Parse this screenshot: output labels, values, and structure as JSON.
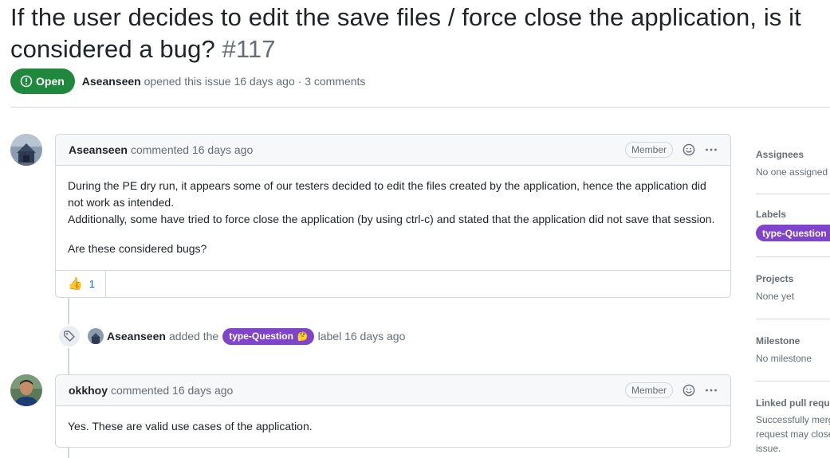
{
  "issue": {
    "title": "If the user decides to edit the save files / force close the application, is it considered a bug?",
    "number": "#117",
    "state": "Open",
    "author": "Aseanseen",
    "meta_suffix": "opened this issue 16 days ago · 3 comments"
  },
  "comments": [
    {
      "author": "Aseanseen",
      "action": "commented 16 days ago",
      "role": "Member",
      "body": [
        "During the PE dry run, it appears some of our testers decided to edit the files created by the application, hence the application did not work as intended.",
        "Additionally, some have tried to force close the application (by using ctrl-c) and stated that the application did not save that session.",
        "Are these considered bugs?"
      ],
      "reaction": {
        "emoji": "👍",
        "count": "1"
      }
    },
    {
      "author": "okkhoy",
      "action": "commented 16 days ago",
      "role": "Member",
      "body": [
        "Yes. These are valid use cases of the application."
      ]
    }
  ],
  "event": {
    "actor": "Aseanseen",
    "prefix": "added the",
    "label": "type-Question",
    "label_emoji": "🤔",
    "suffix": "label 16 days ago"
  },
  "sidebar": {
    "assignees": {
      "title": "Assignees",
      "value": "No one assigned"
    },
    "labels": {
      "title": "Labels",
      "label": "type-Question 🤔"
    },
    "projects": {
      "title": "Projects",
      "value": "None yet"
    },
    "milestone": {
      "title": "Milestone",
      "value": "No milestone"
    },
    "linked_prs": {
      "title": "Linked pull requests",
      "value": "Successfully merging a pull request may close this issue."
    }
  },
  "colors": {
    "open_green": "#1f883d",
    "label_purple": "#7f44c9",
    "border": "#d0d7de",
    "muted": "#656d76",
    "link": "#0969da"
  }
}
